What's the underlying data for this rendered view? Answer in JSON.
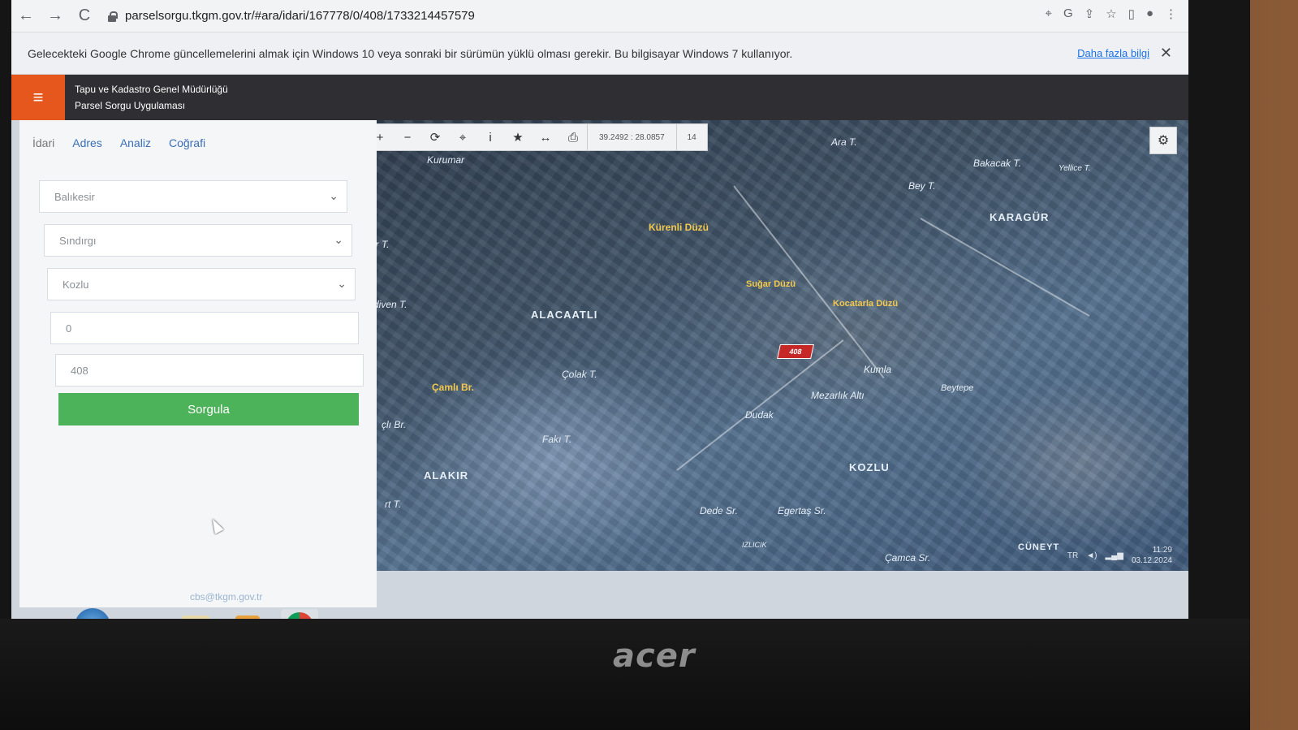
{
  "browser": {
    "url": "parselsorgu.tkgm.gov.tr/#ara/idari/167778/0/408/1733214457579",
    "back_icon": "←",
    "forward_icon": "→",
    "reload_icon": "C"
  },
  "infobar": {
    "message": "Gelecekteki Google Chrome güncellemelerini almak için Windows 10 veya sonraki bir sürümün yüklü olması gerekir. Bu bilgisayar Windows 7 kullanıyor.",
    "link": "Daha fazla bilgi",
    "close": "✕"
  },
  "app": {
    "menu_icon": "≡",
    "title_line1": "Tapu ve Kadastro Genel Müdürlüğü",
    "title_line2": "Parsel Sorgu Uygulaması",
    "accent_color": "#e6571e"
  },
  "panel": {
    "tabs": [
      "İdari",
      "Adres",
      "Analiz",
      "Coğrafi"
    ],
    "province": "Balıkesir",
    "district": "Sındırgı",
    "neighborhood": "Kozlu",
    "block": "0",
    "parcel": "408",
    "query_button": "Sorgula",
    "footer_email": "cbs@tkgm.gov.tr"
  },
  "map": {
    "tools": [
      "+",
      "−",
      "⟳",
      "⌖",
      "i",
      "★",
      "↔",
      "⎙"
    ],
    "coordinates": "39.2492 : 28.0857",
    "zoom_level": "14",
    "parcel_label": "408",
    "labels": {
      "kurumar": "Kurumar",
      "ara_t": "Ara T.",
      "bakacak_t": "Bakacak T.",
      "yellice": "Yellice T.",
      "bey_t": "Bey T.",
      "karagur": "KARAGÜR",
      "kurenli": "Kürenli Düzü",
      "sugar": "Suğar Düzü",
      "koca": "Kocatarla Düzü",
      "alacaatli": "ALACAATLI",
      "cirt": "er T.",
      "diven": "diven T.",
      "colak": "Çolak T.",
      "camli": "Çamlı Br.",
      "cli_br": "çlı Br.",
      "kumla": "Kumla",
      "beytepe": "Beytepe",
      "mezarlik": "Mezarlık Altı",
      "dudak": "Dudak",
      "faki": "Fakı T.",
      "alakir": "ALAKIR",
      "kozlu": "KOZLU",
      "dede": "Dede Sr.",
      "egertas": "Egertaş Sr.",
      "izlicik": "IZLICIK",
      "camca": "Çamca Sr.",
      "rt_t": "rt T.",
      "cuneyt": "CÜNEYT"
    }
  },
  "system": {
    "lang": "TR",
    "time": "11:29",
    "date": "03.12.2024",
    "brand": "acer"
  }
}
